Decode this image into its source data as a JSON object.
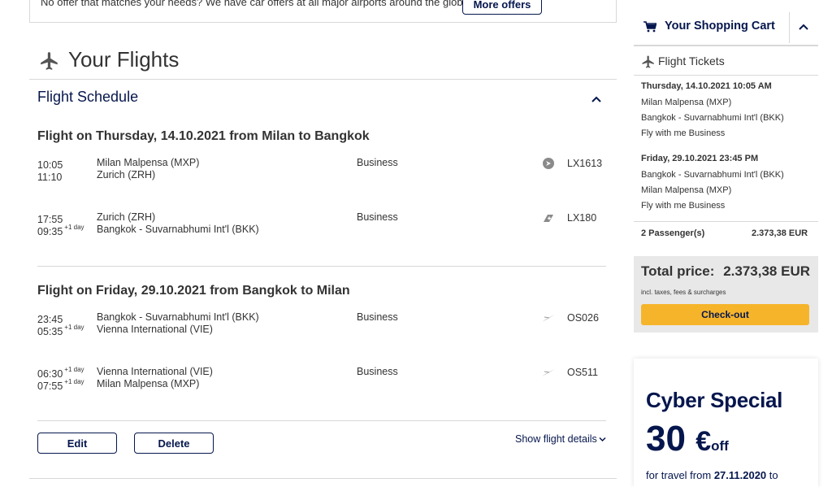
{
  "banner": {
    "text": "No offer that matches your needs? We have car offers at all major airports around the globe!",
    "button": "More offers"
  },
  "flights": {
    "title": "Your Flights",
    "schedule_title": "Flight Schedule",
    "legs": [
      {
        "title": "Flight on Thursday, 14.10.2021 from Milan to Bangkok",
        "segments": [
          {
            "dep_time": "10:05",
            "dep_day": "",
            "arr_time": "11:10",
            "arr_day": "",
            "from": "Milan Malpensa (MXP)",
            "to": "Zurich (ZRH)",
            "class": "Business",
            "flight": "LX1613",
            "logo": "swiss-logo-icon"
          },
          {
            "dep_time": "17:55",
            "dep_day": "",
            "arr_time": "09:35",
            "arr_day": "+1 day",
            "from": "Zurich (ZRH)",
            "to": "Bangkok - Suvarnabhumi Int'l (BKK)",
            "class": "Business",
            "flight": "LX180",
            "logo": "swiss-tail-icon"
          }
        ]
      },
      {
        "title": "Flight on Friday, 29.10.2021 from Bangkok to Milan",
        "segments": [
          {
            "dep_time": "23:45",
            "dep_day": "",
            "arr_time": "05:35",
            "arr_day": "+1 day",
            "from": "Bangkok - Suvarnabhumi Int'l (BKK)",
            "to": "Vienna International (VIE)",
            "class": "Business",
            "flight": "OS026",
            "logo": "austrian-arrow-icon"
          },
          {
            "dep_time": "06:30",
            "dep_day": "+1 day",
            "arr_time": "07:55",
            "arr_day": "+1 day",
            "from": "Vienna International (VIE)",
            "to": "Milan Malpensa (MXP)",
            "class": "Business",
            "flight": "OS511",
            "logo": "austrian-arrow-icon"
          }
        ]
      }
    ],
    "edit_button": "Edit",
    "delete_button": "Delete",
    "details_link": "Show flight details"
  },
  "cart": {
    "title": "Your Shopping Cart",
    "section_title": "Flight Tickets",
    "outbound": {
      "date": "Thursday, 14.10.2021 10:05 AM",
      "from": "Milan Malpensa (MXP)",
      "to": "Bangkok - Suvarnabhumi Int'l (BKK)",
      "fare": "Fly with me Business"
    },
    "inbound": {
      "date": "Friday, 29.10.2021 23:45 PM",
      "from": "Bangkok - Suvarnabhumi Int'l (BKK)",
      "to": "Milan Malpensa (MXP)",
      "fare": "Fly with me Business"
    },
    "passengers": "2 Passenger(s)",
    "passengers_price": "2.373,38 EUR",
    "total_label": "Total price:",
    "total_price": "2.373,38 EUR",
    "total_note": "incl. taxes, fees & surcharges",
    "checkout": "Check-out"
  },
  "promo": {
    "title": "Cyber Special",
    "amount": "30",
    "currency": "€",
    "off": "off",
    "text_prefix": "for travel from",
    "text_date": "27.11.2020",
    "text_suffix": "to"
  },
  "colors": {
    "brand": "#05164d",
    "checkout": "#f6b42a",
    "total_bg": "#e8e8e8",
    "divider": "#d8d8d8"
  }
}
